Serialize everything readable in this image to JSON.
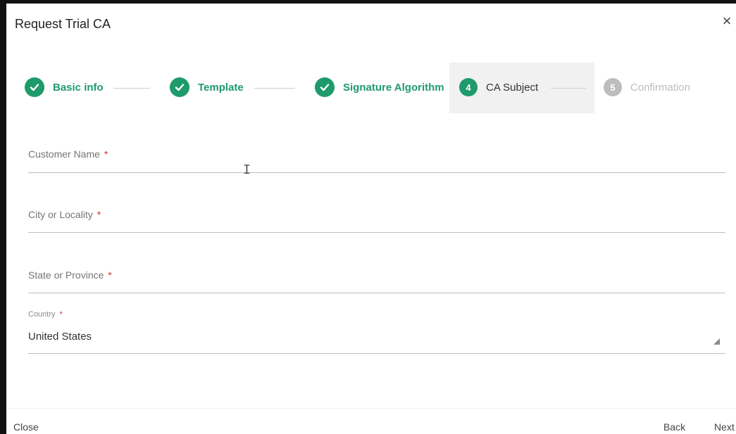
{
  "dialog": {
    "title": "Request Trial CA",
    "close_icon": "close-icon"
  },
  "stepper": {
    "steps": [
      {
        "number": "1",
        "label": "Basic info",
        "state": "done"
      },
      {
        "number": "2",
        "label": "Template",
        "state": "done"
      },
      {
        "number": "3",
        "label": "Signature Algorithm",
        "state": "done"
      },
      {
        "number": "4",
        "label": "CA Subject",
        "state": "active"
      },
      {
        "number": "5",
        "label": "Confirmation",
        "state": "pending"
      }
    ],
    "check_icon": "check-icon"
  },
  "form": {
    "customer_name": {
      "label": "Customer Name",
      "required_mark": "*",
      "value": ""
    },
    "city": {
      "label": "City or Locality",
      "required_mark": "*",
      "value": ""
    },
    "state": {
      "label": "State or Province",
      "required_mark": "*",
      "value": ""
    },
    "country": {
      "label": "Country",
      "required_mark": "*",
      "value": "United States"
    }
  },
  "footer": {
    "close_label": "Close",
    "back_label": "Back",
    "next_label": "Next"
  },
  "colors": {
    "accent": "#1e9a6b",
    "required": "#d32f2f",
    "pending": "#bdbdbd"
  }
}
